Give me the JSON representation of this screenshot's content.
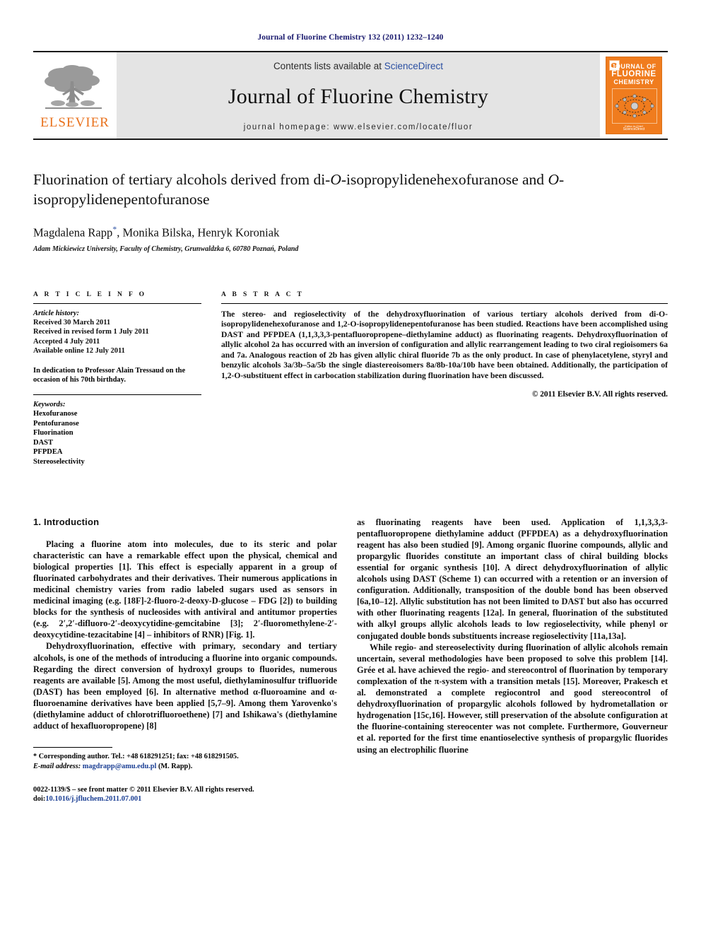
{
  "running_head": "Journal of Fluorine Chemistry 132 (2011) 1232–1240",
  "masthead": {
    "contents_prefix": "Contents lists available at ",
    "sciencedirect": "ScienceDirect",
    "journal_name": "Journal of Fluorine Chemistry",
    "homepage": "journal homepage: www.elsevier.com/locate/fluor",
    "publisher_logo_text": "ELSEVIER",
    "cover": {
      "line1": "JOURNAL OF",
      "line2": "FLUORINE",
      "line3": "CHEMISTRY",
      "footer1": "Editor-in-Chief",
      "footer2": "ScienceDirect"
    },
    "accent_orange": "#F07C1E",
    "link_blue": "#2a4fa2",
    "band_gray": "#e4e4e4"
  },
  "article": {
    "title_line1": "Fluorination of tertiary alcohols derived from di-",
    "title_italic1": "O",
    "title_line1b": "-isopropylidenehexofuranose",
    "title_line2a": "and ",
    "title_italic2": "O",
    "title_line2b": "-isopropylidenepentofuranose",
    "authors": "Magdalena Rapp",
    "authors_rest": ", Monika Bilska, Henryk Koroniak",
    "corresponding_marker": "*",
    "affiliation": "Adam Mickiewicz University, Faculty of Chemistry, Grunwaldzka 6, 60780 Poznań, Poland"
  },
  "article_info": {
    "heading": "A R T I C L E   I N F O",
    "history_label": "Article history:",
    "history": [
      "Received 30 March 2011",
      "Received in revised form 1 July 2011",
      "Accepted 4 July 2011",
      "Available online 12 July 2011"
    ],
    "dedication": "In dedication to Professor Alain Tressaud on the occasion of his 70th birthday.",
    "keywords_label": "Keywords:",
    "keywords": [
      "Hexofuranose",
      "Pentofuranose",
      "Fluorination",
      "DAST",
      "PFPDEA",
      "Stereoselectivity"
    ]
  },
  "abstract": {
    "heading": "A B S T R A C T",
    "text": "The stereo- and regioselectivity of the dehydroxyfluorination of various tertiary alcohols derived from di-O-isopropylidenehexofuranose and 1,2-O-isopropylidenepentofuranose has been studied. Reactions have been accomplished using DAST and PFPDEA (1,1,3,3,3-pentafluoropropene–diethylamine adduct) as fluorinating reagents. Dehydroxyfluorination of allylic alcohol 2a has occurred with an inversion of configuration and allylic rearrangement leading to two ciral regioisomers 6a and 7a. Analogous reaction of 2b has given allylic chiral fluoride 7b as the only product. In case of phenylacetylene, styryl and benzylic alcohols 3a/3b–5a/5b the single diastereoisomers 8a/8b-10a/10b have been obtained. Additionally, the participation of 1,2-O-substituent effect in carbocation stabilization during fluorination have been discussed.",
    "copyright": "© 2011 Elsevier B.V. All rights reserved."
  },
  "body": {
    "section_heading": "1. Introduction",
    "left_paragraph_1": "Placing a fluorine atom into molecules, due to its steric and polar characteristic can have a remarkable effect upon the physical, chemical and biological properties [1]. This effect is especially apparent in a group of fluorinated carbohydrates and their derivatives. Their numerous applications in medicinal chemistry varies from radio labeled sugars used as sensors in medicinal imaging (e.g. [18F]-2-fluoro-2-deoxy-D-glucose – FDG [2]) to building blocks for the synthesis of nucleosides with antiviral and antitumor properties (e.g. 2′,2′-difluoro-2′-deoxycytidine-gemcitabine [3]; 2′-fluoromethylene-2′-deoxycytidine-tezacitabine [4] – inhibitors of RNR) [Fig. 1].",
    "left_paragraph_2": "Dehydroxyfluorination, effective with primary, secondary and tertiary alcohols, is one of the methods of introducing a fluorine into organic compounds. Regarding the direct conversion of hydroxyl groups to fluorides, numerous reagents are available [5]. Among the most useful, diethylaminosulfur trifluoride (DAST) has been employed [6]. In alternative method α-fluoroamine and α-fluoroenamine derivatives have been applied [5,7–9]. Among them Yarovenko's (diethylamine adduct of chlorotrifluoroethene) [7] and Ishikawa's (diethylamine adduct of hexafluoropropene) [8]",
    "right_paragraph_1": "as fluorinating reagents have been used. Application of 1,1,3,3,3-pentafluoropropene diethylamine adduct (PFPDEA) as a dehydroxyfluorination reagent has also been studied [9]. Among organic fluorine compounds, allylic and propargylic fluorides constitute an important class of chiral building blocks essential for organic synthesis [10]. A direct dehydroxyfluorination of allylic alcohols using DAST (Scheme 1) can occurred with a retention or an inversion of configuration. Additionally, transposition of the double bond has been observed [6a,10–12]. Allylic substitution has not been limited to DAST but also has occurred with other fluorinating reagents [12a]. In general, fluorination of the substituted with alkyl groups allylic alcohols leads to low regioselectivity, while phenyl or conjugated double bonds substituents increase regioselectivity [11a,13a].",
    "right_paragraph_2": "While regio- and stereoselectivity during fluorination of allylic alcohols remain uncertain, several methodologies have been proposed to solve this problem [14]. Grée et al. have achieved the regio- and stereocontrol of fluorination by temporary complexation of the π-system with a transition metals [15]. Moreover, Prakesch et al. demonstrated a complete regiocontrol and good stereocontrol of dehydroxyfluorination of propargylic alcohols followed by hydrometallation or hydrogenation [15c,16]. However, still preservation of the absolute configuration at the fluorine-containing stereocenter was not complete. Furthermore, Gouverneur et al. reported for the first time enantioselective synthesis of propargylic fluorides using an electrophilic fluorine"
  },
  "footnote": {
    "star": "*",
    "corresponding": "Corresponding author. Tel.: +48 618291251; fax: +48 618291505.",
    "email_label": "E-mail address:",
    "email": "magdrapp@amu.edu.pl",
    "email_suffix": "(M. Rapp).",
    "issn_line": "0022-1139/$ – see front matter © 2011 Elsevier B.V. All rights reserved.",
    "doi_label": "doi:",
    "doi": "10.1016/j.jfluchem.2011.07.001"
  }
}
